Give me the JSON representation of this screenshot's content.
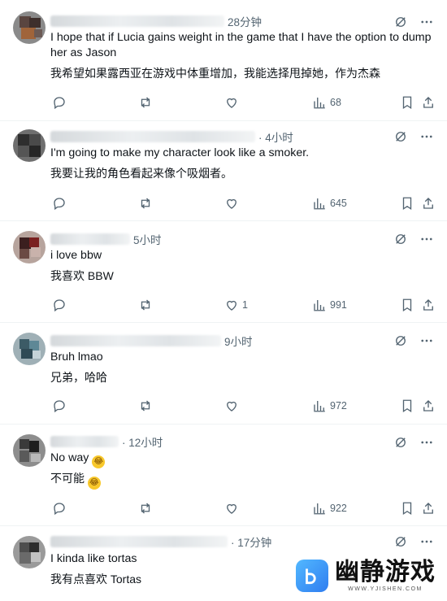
{
  "tweets": [
    {
      "time": "28分钟",
      "text_en": "I hope that if Lucia gains weight in the game that I have the option to dump her as Jason",
      "text_zh": "我希望如果露西亚在游戏中体重增加，我能选择甩掉她，作为杰森",
      "likes": "",
      "views": "68"
    },
    {
      "time": "· 4小时",
      "text_en": "I'm going to make my character look like a smoker.",
      "text_zh": "我要让我的角色看起来像个吸烟者。",
      "likes": "",
      "views": "645"
    },
    {
      "time": "5小时",
      "text_en": "i love bbw",
      "text_zh": "我喜欢 BBW",
      "likes": "1",
      "views": "991"
    },
    {
      "time": "9小时",
      "text_en": "Bruh lmao",
      "text_zh": "兄弟，哈哈",
      "likes": "",
      "views": "972"
    },
    {
      "time": "· 12小时",
      "text_en": "No way",
      "text_zh": "不可能",
      "likes": "",
      "views": "922"
    },
    {
      "time": "· 17分钟",
      "text_en": "I kinda like tortas",
      "text_zh": "我有点喜欢 Tortas"
    }
  ],
  "icons": {
    "reply": "reply-icon",
    "retweet": "retweet-icon",
    "like": "heart-icon",
    "views": "views-icon",
    "bookmark": "bookmark-icon",
    "share": "share-icon",
    "grok": "grok-icon",
    "more": "more-icon",
    "emoji": "laughing-emoji"
  },
  "watermark": {
    "title": "幽静游戏",
    "subtitle": "WWW.YJISHEN.COM"
  },
  "colors": {
    "text": "#0f1419",
    "secondary": "#536471",
    "divider": "#eff3f4",
    "watermark_blue": "#2f7df0"
  }
}
